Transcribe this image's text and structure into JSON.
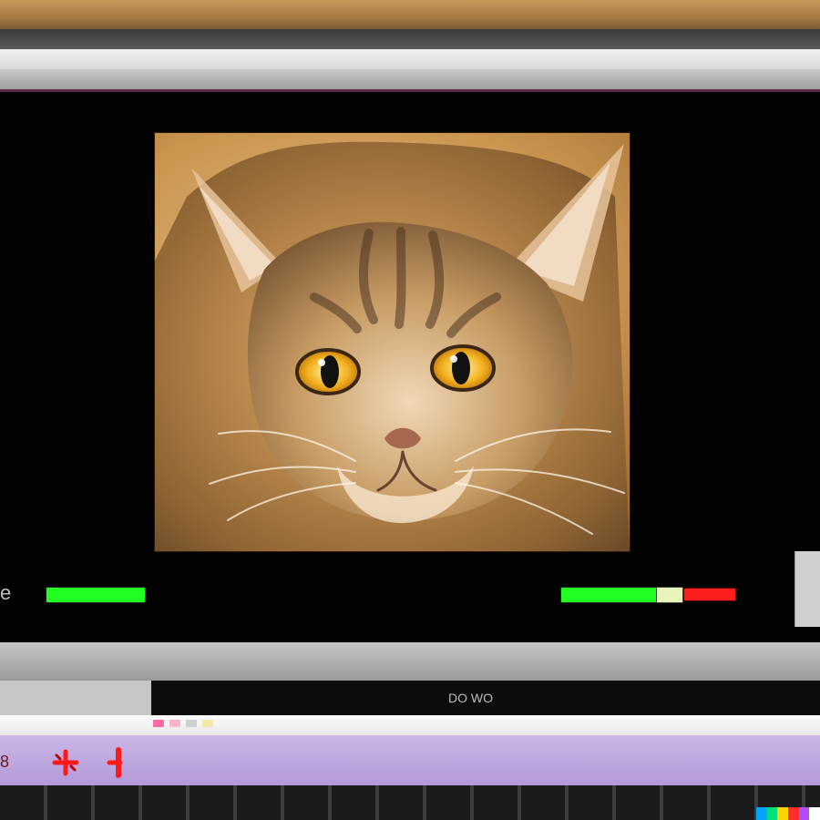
{
  "viewer": {
    "left_edge_label": "e",
    "label_left": "",
    "label_right": "",
    "status_text": "DO WO",
    "bottom_caption": "",
    "progress_left_percent": 100,
    "progress_right_percent": 79
  },
  "toolbar": {
    "left_glyph": "8"
  },
  "icons": {
    "add": "plus-icon",
    "marker": "marker-icon"
  },
  "colors": {
    "progress": "#22ff22",
    "alert": "#ff1e1e",
    "toolbar": "#c2a9e0",
    "viewer_bg": "#020202"
  }
}
